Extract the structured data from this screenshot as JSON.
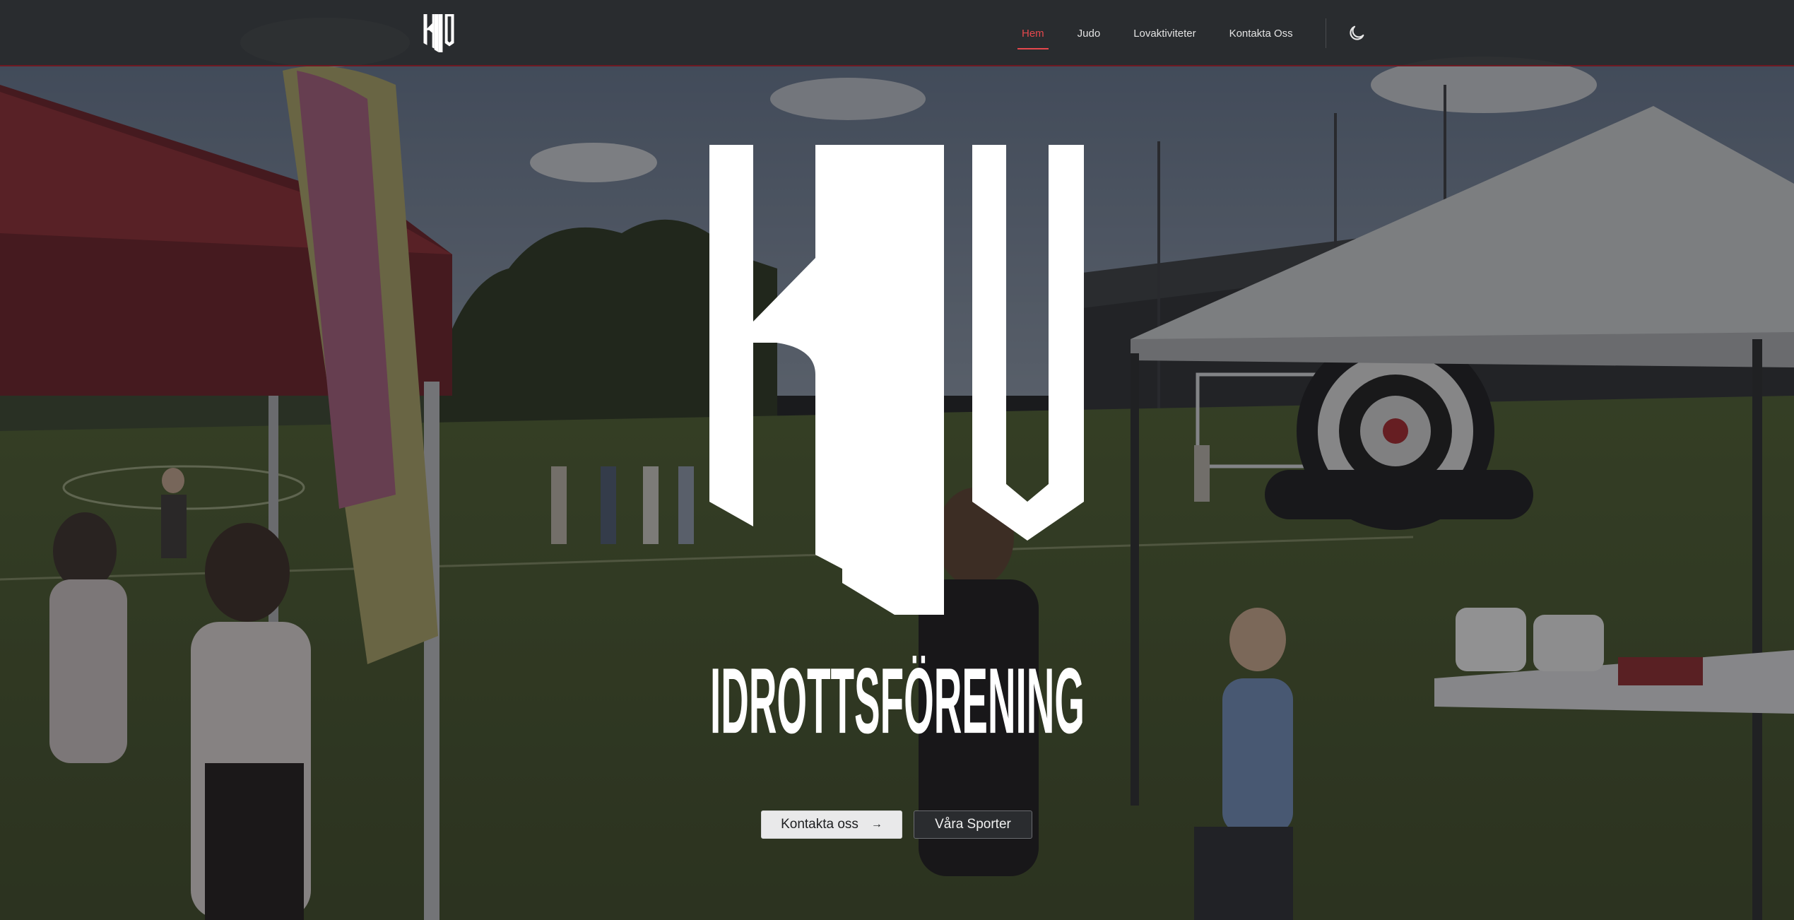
{
  "header": {
    "logo_alt": "KIIV",
    "nav": [
      {
        "label": "Hem",
        "active": true
      },
      {
        "label": "Judo",
        "active": false
      },
      {
        "label": "Lovaktiviteter",
        "active": false
      },
      {
        "label": "Kontakta Oss",
        "active": false
      }
    ],
    "theme_toggle_icon": "moon-icon"
  },
  "hero": {
    "logo_text": "KIIV",
    "wordmark": "IDROTTSFÖRENING",
    "primary_button": "Kontakta oss",
    "primary_button_icon": "arrow-right-icon",
    "secondary_button": "Våra Sporter"
  },
  "colors": {
    "accent": "#e5484d",
    "header_bg": "#2a2c2e",
    "primary_button_bg": "#e9e9ea",
    "secondary_button_bg": "#2a2c2f"
  }
}
